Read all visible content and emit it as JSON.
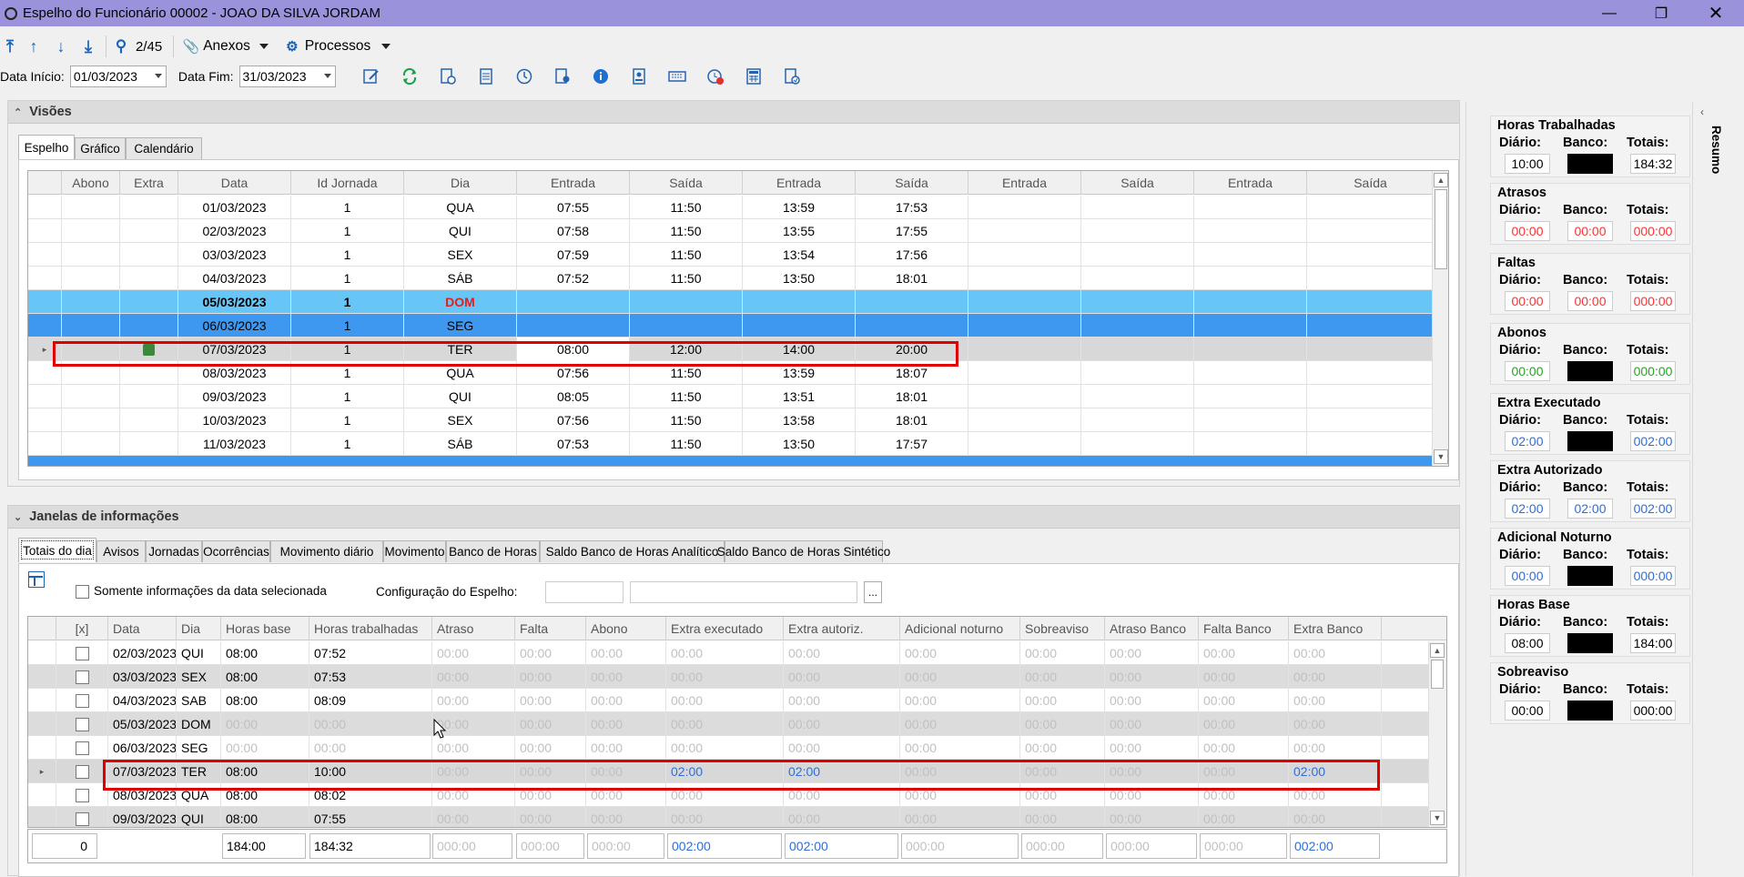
{
  "window": {
    "title": "Espelho do Funcionário 00002 - JOAO DA SILVA JORDAM"
  },
  "toolbar": {
    "record_pos": "2/45",
    "anexos": "Anexos",
    "processos": "Processos"
  },
  "filters": {
    "data_inicio_label": "Data Início:",
    "data_inicio": "01/03/2023",
    "data_fim_label": "Data Fim:",
    "data_fim": "31/03/2023"
  },
  "visoes": {
    "title": "Visões",
    "tabs": [
      "Espelho",
      "Gráfico",
      "Calendário"
    ],
    "columns": [
      "Abono",
      "Extra",
      "Data",
      "Id Jornada",
      "Dia",
      "Entrada",
      "Saída",
      "Entrada",
      "Saída",
      "Entrada",
      "Saída",
      "Entrada",
      "Saída"
    ],
    "rows": [
      {
        "data": "01/03/2023",
        "id": "1",
        "dia": "QUA",
        "e1": "07:55",
        "s1": "11:50",
        "e2": "13:59",
        "s2": "17:53"
      },
      {
        "data": "02/03/2023",
        "id": "1",
        "dia": "QUI",
        "e1": "07:58",
        "s1": "11:50",
        "e2": "13:55",
        "s2": "17:55"
      },
      {
        "data": "03/03/2023",
        "id": "1",
        "dia": "SEX",
        "e1": "07:59",
        "s1": "11:50",
        "e2": "13:54",
        "s2": "17:56"
      },
      {
        "data": "04/03/2023",
        "id": "1",
        "dia": "SÁB",
        "e1": "07:52",
        "s1": "11:50",
        "e2": "13:50",
        "s2": "18:01"
      },
      {
        "data": "05/03/2023",
        "id": "1",
        "dia": "DOM",
        "e1": "",
        "s1": "",
        "e2": "",
        "s2": ""
      },
      {
        "data": "06/03/2023",
        "id": "1",
        "dia": "SEG",
        "e1": "",
        "s1": "",
        "e2": "",
        "s2": ""
      },
      {
        "data": "07/03/2023",
        "id": "1",
        "dia": "TER",
        "e1": "08:00",
        "s1": "12:00",
        "e2": "14:00",
        "s2": "20:00"
      },
      {
        "data": "08/03/2023",
        "id": "1",
        "dia": "QUA",
        "e1": "07:56",
        "s1": "11:50",
        "e2": "13:59",
        "s2": "18:07"
      },
      {
        "data": "09/03/2023",
        "id": "1",
        "dia": "QUI",
        "e1": "08:05",
        "s1": "11:50",
        "e2": "13:51",
        "s2": "18:01"
      },
      {
        "data": "10/03/2023",
        "id": "1",
        "dia": "SEX",
        "e1": "07:56",
        "s1": "11:50",
        "e2": "13:58",
        "s2": "18:01"
      },
      {
        "data": "11/03/2023",
        "id": "1",
        "dia": "SÁB",
        "e1": "07:53",
        "s1": "11:50",
        "e2": "13:50",
        "s2": "17:57"
      }
    ]
  },
  "janelas": {
    "title": "Janelas de informações",
    "tabs": [
      "Totais do dia",
      "Avisos",
      "Jornadas",
      "Ocorrências",
      "Movimento diário",
      "Movimento",
      "Banco de Horas",
      "Saldo Banco de Horas Analítico",
      "Saldo Banco de Horas Sintético"
    ],
    "somente_label": "Somente informações da data selecionada",
    "config_label": "Configuração do Espelho:",
    "ellipsis": "...",
    "columns": [
      "[x]",
      "Data",
      "Dia",
      "Horas base",
      "Horas trabalhadas",
      "Atraso",
      "Falta",
      "Abono",
      "Extra executado",
      "Extra autoriz.",
      "Adicional noturno",
      "Sobreaviso",
      "Atraso Banco",
      "Falta Banco",
      "Extra Banco"
    ],
    "rows": [
      {
        "data": "02/03/2023",
        "dia": "QUI",
        "base": "08:00",
        "trab": "07:52",
        "vals": [
          "00:00",
          "00:00",
          "00:00",
          "00:00",
          "00:00",
          "00:00",
          "00:00",
          "00:00",
          "00:00",
          "00:00"
        ]
      },
      {
        "data": "03/03/2023",
        "dia": "SEX",
        "base": "08:00",
        "trab": "07:53",
        "vals": [
          "00:00",
          "00:00",
          "00:00",
          "00:00",
          "00:00",
          "00:00",
          "00:00",
          "00:00",
          "00:00",
          "00:00"
        ]
      },
      {
        "data": "04/03/2023",
        "dia": "SAB",
        "base": "08:00",
        "trab": "08:09",
        "vals": [
          "00:00",
          "00:00",
          "00:00",
          "00:00",
          "00:00",
          "00:00",
          "00:00",
          "00:00",
          "00:00",
          "00:00"
        ]
      },
      {
        "data": "05/03/2023",
        "dia": "DOM",
        "base": "00:00",
        "trab": "00:00",
        "vals": [
          "00:00",
          "00:00",
          "00:00",
          "00:00",
          "00:00",
          "00:00",
          "00:00",
          "00:00",
          "00:00",
          "00:00"
        ]
      },
      {
        "data": "06/03/2023",
        "dia": "SEG",
        "base": "00:00",
        "trab": "00:00",
        "vals": [
          "00:00",
          "00:00",
          "00:00",
          "00:00",
          "00:00",
          "00:00",
          "00:00",
          "00:00",
          "00:00",
          "00:00"
        ]
      },
      {
        "data": "07/03/2023",
        "dia": "TER",
        "base": "08:00",
        "trab": "10:00",
        "vals": [
          "00:00",
          "00:00",
          "00:00",
          "02:00",
          "02:00",
          "00:00",
          "00:00",
          "00:00",
          "00:00",
          "02:00"
        ]
      },
      {
        "data": "08/03/2023",
        "dia": "QUA",
        "base": "08:00",
        "trab": "08:02",
        "vals": [
          "00:00",
          "00:00",
          "00:00",
          "00:00",
          "00:00",
          "00:00",
          "00:00",
          "00:00",
          "00:00",
          "00:00"
        ]
      },
      {
        "data": "09/03/2023",
        "dia": "QUI",
        "base": "08:00",
        "trab": "07:55",
        "vals": [
          "00:00",
          "00:00",
          "00:00",
          "00:00",
          "00:00",
          "00:00",
          "00:00",
          "00:00",
          "00:00",
          "00:00"
        ]
      }
    ],
    "totals": {
      "count": "0",
      "base": "184:00",
      "trab": "184:32",
      "vals": [
        "000:00",
        "000:00",
        "000:00",
        "002:00",
        "002:00",
        "000:00",
        "000:00",
        "000:00",
        "000:00",
        "002:00"
      ]
    }
  },
  "resumo": {
    "label": "Resumo",
    "col_labels": [
      "Diário:",
      "Banco:",
      "Totais:"
    ],
    "groups": [
      {
        "title": "Horas Trabalhadas",
        "diario": "10:00",
        "banco": "",
        "totais": "184:32",
        "color": "#000000",
        "banco_black": true
      },
      {
        "title": "Atrasos",
        "diario": "00:00",
        "banco": "00:00",
        "totais": "000:00",
        "color": "#ff3030",
        "banco_black": false
      },
      {
        "title": "Faltas",
        "diario": "00:00",
        "banco": "00:00",
        "totais": "000:00",
        "color": "#ff3030",
        "banco_black": false
      },
      {
        "title": "Abonos",
        "diario": "00:00",
        "banco": "",
        "totais": "000:00",
        "color": "#2aa02a",
        "banco_black": true
      },
      {
        "title": "Extra Executado",
        "diario": "02:00",
        "banco": "",
        "totais": "002:00",
        "color": "#2f6ed6",
        "banco_black": true
      },
      {
        "title": "Extra Autorizado",
        "diario": "02:00",
        "banco": "02:00",
        "totais": "002:00",
        "color": "#2f6ed6",
        "banco_black": false
      },
      {
        "title": "Adicional Noturno",
        "diario": "00:00",
        "banco": "",
        "totais": "000:00",
        "color": "#2f6ed6",
        "banco_black": true
      },
      {
        "title": "Horas Base",
        "diario": "08:00",
        "banco": "",
        "totais": "184:00",
        "color": "#000000",
        "banco_black": true
      },
      {
        "title": "Sobreaviso",
        "diario": "00:00",
        "banco": "",
        "totais": "000:00",
        "color": "#000000",
        "banco_black": true
      }
    ]
  }
}
